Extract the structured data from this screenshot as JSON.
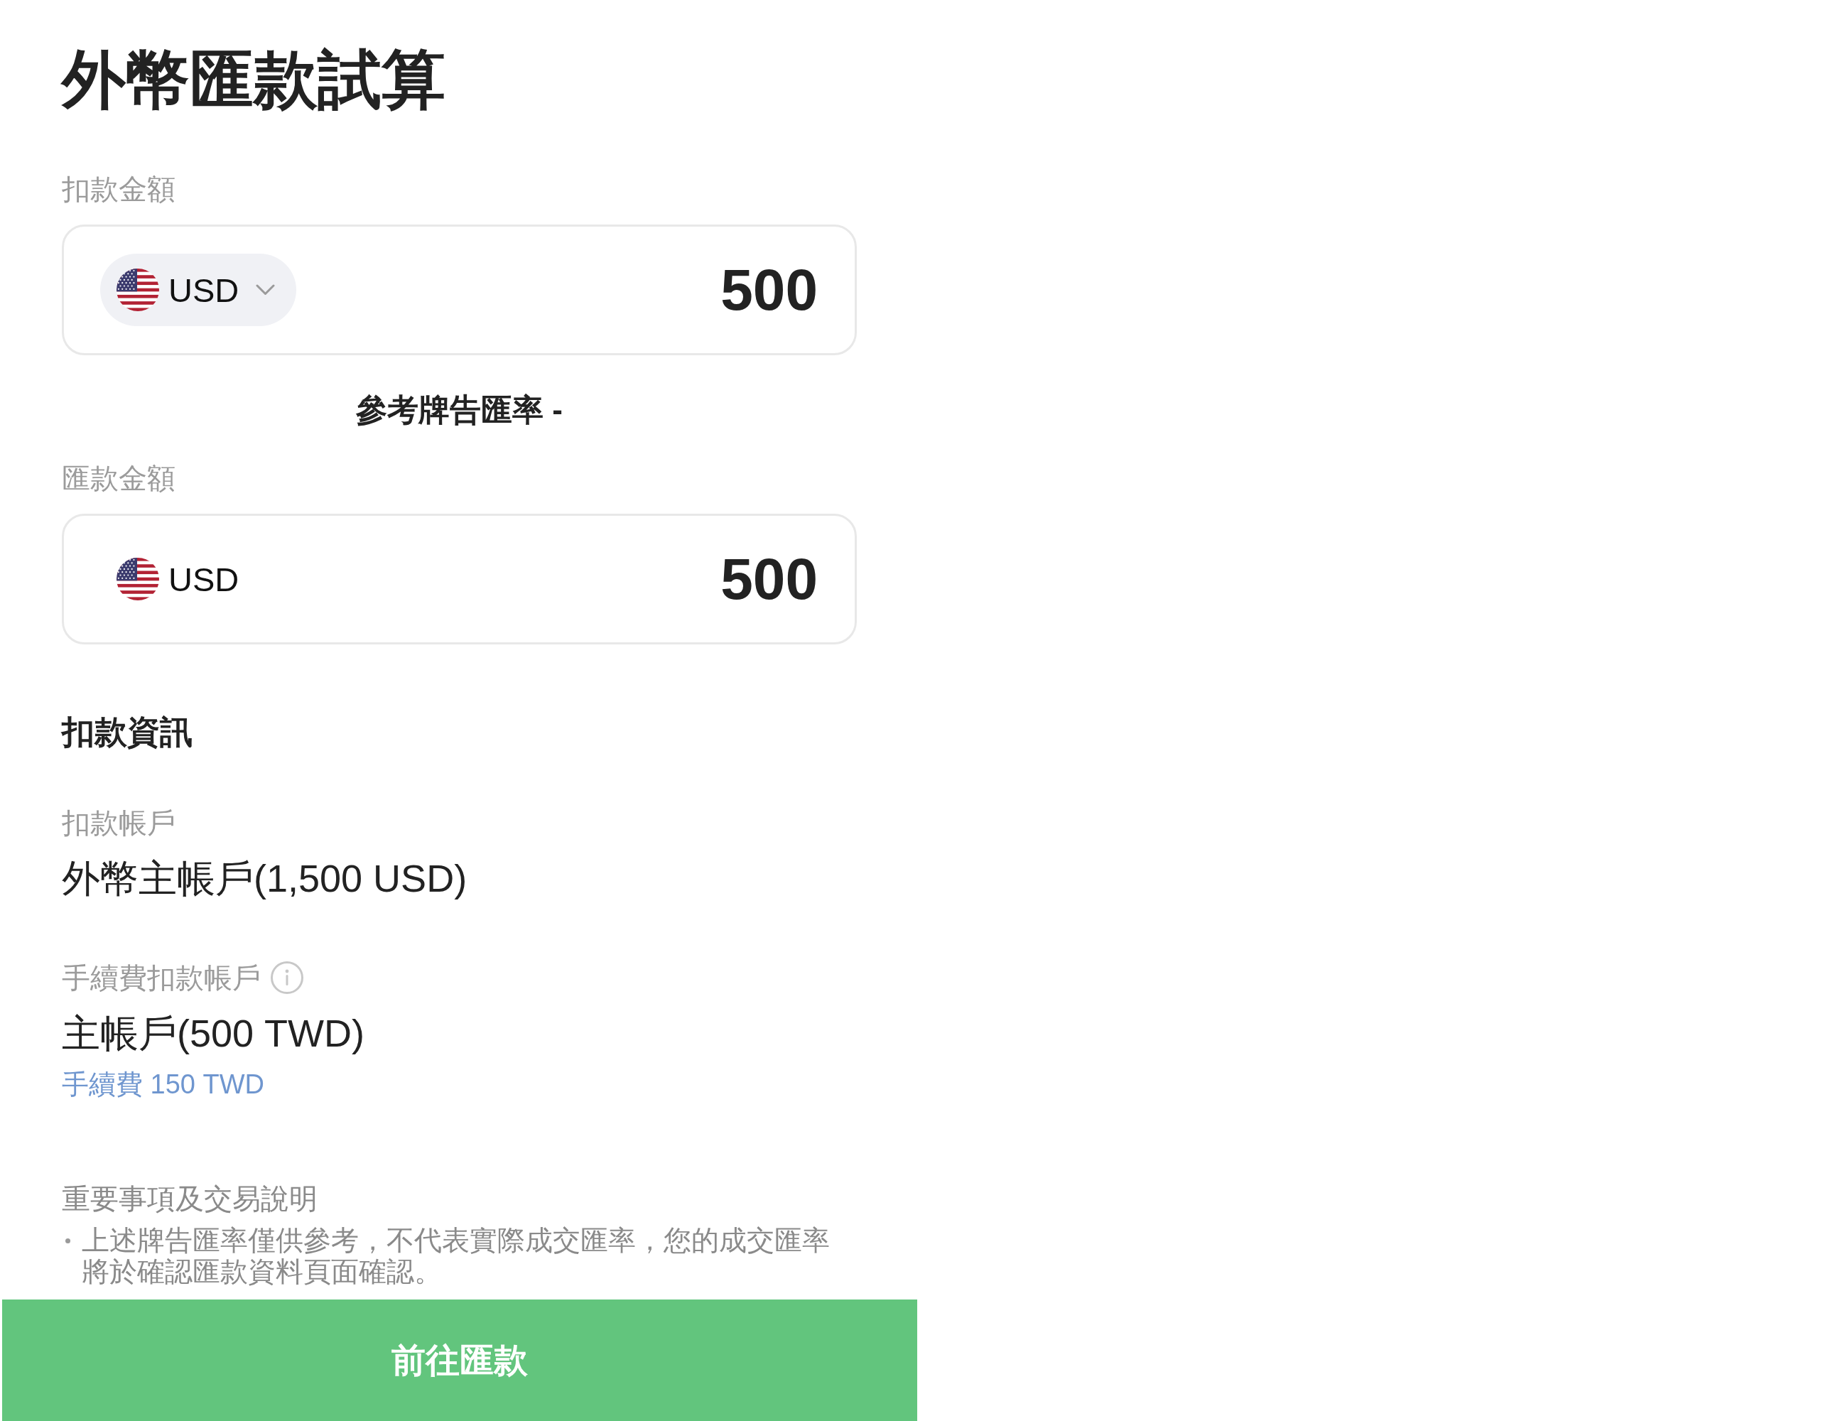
{
  "title": "外幣匯款試算",
  "debit_amount": {
    "label": "扣款金額",
    "currency": "USD",
    "currency_selectable": true,
    "amount": "500"
  },
  "reference_rate": "參考牌告匯率 -",
  "remit_amount": {
    "label": "匯款金額",
    "currency": "USD",
    "currency_selectable": false,
    "amount": "500"
  },
  "debit_info": {
    "heading": "扣款資訊",
    "fields": [
      {
        "label": "扣款帳戶",
        "info": false,
        "value": "外幣主帳戶(1,500 USD)"
      },
      {
        "label": "手續費扣款帳戶",
        "info": true,
        "value": "主帳戶(500 TWD)",
        "note": "手續費 150 TWD"
      }
    ]
  },
  "notes": {
    "heading": "重要事項及交易說明",
    "items": [
      "上述牌告匯率僅供參考，不代表實際成交匯率，您的成交匯率將於確認匯款資料頁面確認。"
    ]
  },
  "button": {
    "label": "前往匯款"
  }
}
